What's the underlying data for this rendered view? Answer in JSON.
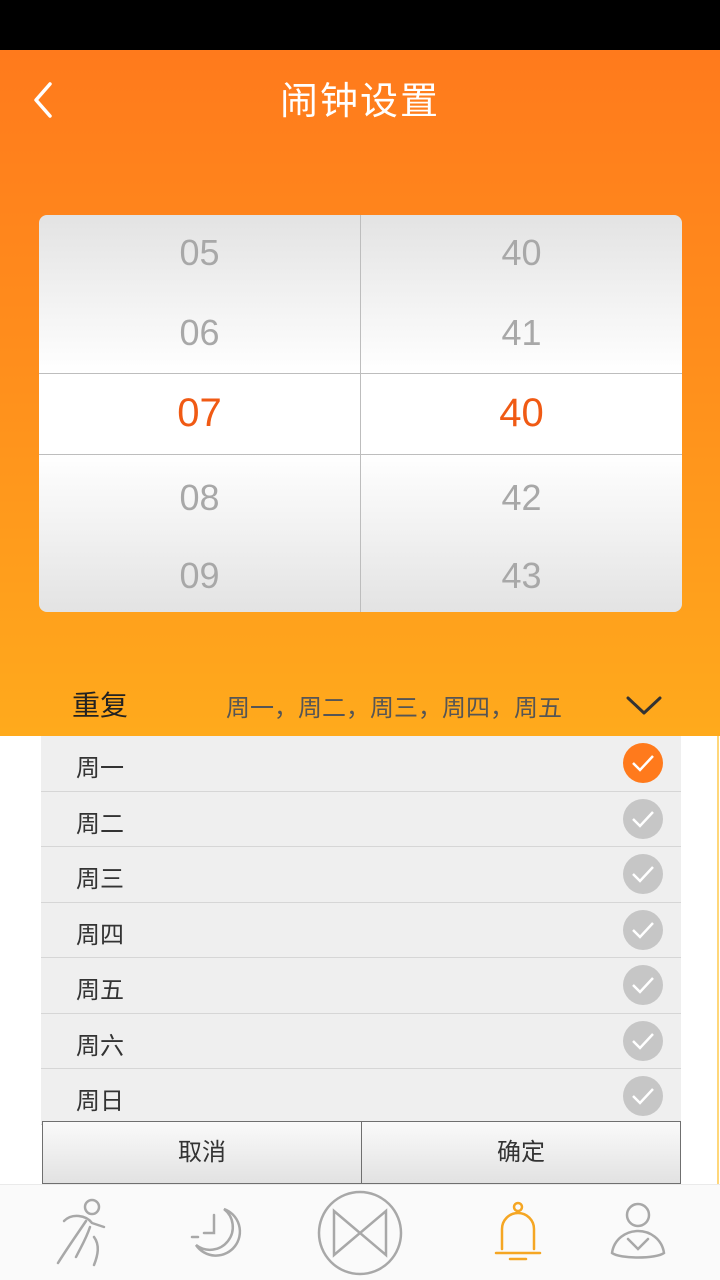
{
  "header": {
    "title": "闹钟设置",
    "back_icon": "chevron-left-icon"
  },
  "picker": {
    "hours": [
      "05",
      "06",
      "07",
      "08",
      "09"
    ],
    "minutes": [
      "40",
      "41",
      "40",
      "42",
      "43"
    ],
    "selected_hour": "07",
    "selected_minute": "40"
  },
  "repeat": {
    "label": "重复",
    "summary": "周一，周二，周三，周四，周五",
    "toggle_icon": "chevron-down-icon"
  },
  "days": [
    {
      "label": "周一",
      "checked": true
    },
    {
      "label": "周二",
      "checked": false
    },
    {
      "label": "周三",
      "checked": false
    },
    {
      "label": "周四",
      "checked": false
    },
    {
      "label": "周五",
      "checked": false
    },
    {
      "label": "周六",
      "checked": false
    },
    {
      "label": "周日",
      "checked": false
    }
  ],
  "actions": {
    "cancel": "取消",
    "confirm": "确定"
  },
  "nav": {
    "items": [
      "run-icon",
      "sleep-moon-icon",
      "center-bowtie-icon",
      "alarm-bell-icon",
      "profile-icon"
    ],
    "active": "alarm-bell-icon"
  },
  "colors": {
    "accent": "#ff7a1c",
    "selected_text": "#f05a14",
    "inactive_icon": "#b0b0b0",
    "active_icon": "#f5a623"
  }
}
